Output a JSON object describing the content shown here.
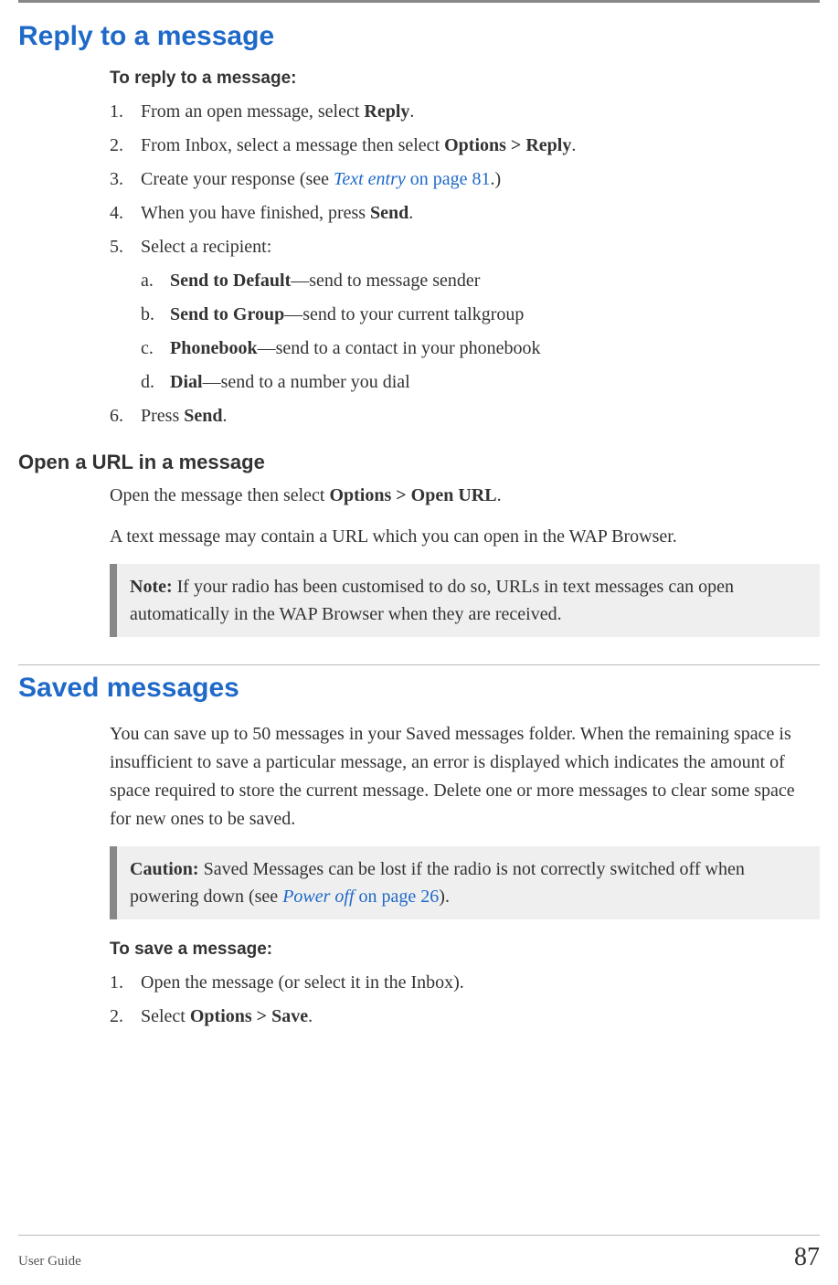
{
  "section1": {
    "heading": "Reply to a message",
    "subhead": "To reply to a message:",
    "steps": {
      "s1_a": "From an open message, select ",
      "s1_b": "Reply",
      "s1_c": ".",
      "s2_a": "From Inbox, select a message then select ",
      "s2_b": "Options > Reply",
      "s2_c": ".",
      "s3_a": "Create your response (see ",
      "s3_link_i": "Text entry",
      "s3_link_p": " on page 81",
      "s3_b": ".)",
      "s4_a": "When you have finished, press ",
      "s4_b": "Send",
      "s4_c": ".",
      "s5_a": "Select a recipient:",
      "s5a_b": "Send to Default",
      "s5a_t": "—send to message sender",
      "s5b_b": "Send to Group",
      "s5b_t": "—send to your current talkgroup",
      "s5c_b": "Phonebook",
      "s5c_t": "—send to a contact in your phonebook",
      "s5d_b": "Dial",
      "s5d_t": "—send to a number you dial",
      "s6_a": "Press ",
      "s6_b": "Send",
      "s6_c": "."
    }
  },
  "section2": {
    "heading": "Open a URL in a message",
    "p1_a": "Open the message then select ",
    "p1_b": "Options > Open URL",
    "p1_c": ".",
    "p2": "A text message may contain a URL which you can open in the WAP Browser.",
    "note_label": "Note:",
    "note_text": "  If your radio has been customised to do so, URLs in text messages can open automatically in the WAP Browser when they are received."
  },
  "section3": {
    "heading": "Saved messages",
    "p1": "You can save up to 50 messages in your Saved messages folder. When the remaining space is insufficient to save a particular message, an error is displayed which indicates the amount of space required to store the current message. Delete one or more messages to clear some space for new ones to be saved.",
    "caution_label": "Caution:",
    "caution_a": "  Saved Messages can be lost if the radio is not correctly switched off when powering down (see ",
    "caution_link_i": "Power off",
    "caution_link_p": " on page 26",
    "caution_c": ").",
    "subhead": "To save a message:",
    "steps": {
      "s1": "Open the message (or select it in the Inbox).",
      "s2_a": "Select ",
      "s2_b": "Options > Save",
      "s2_c": "."
    }
  },
  "footer": {
    "left": "User Guide",
    "right": "87"
  }
}
